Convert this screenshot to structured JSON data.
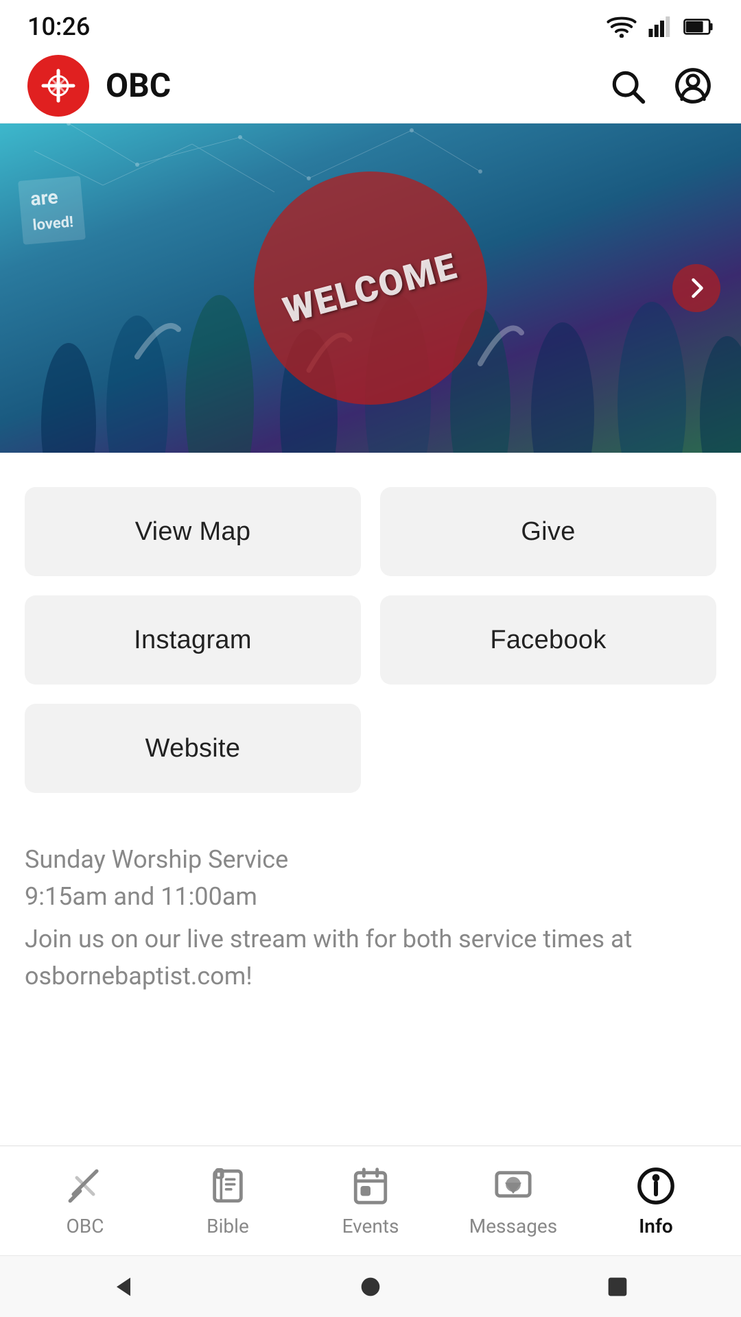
{
  "statusBar": {
    "time": "10:26"
  },
  "header": {
    "appTitle": "OBC",
    "logoAlt": "OBC logo"
  },
  "hero": {
    "welcomeText": "WELCOME"
  },
  "buttons": {
    "viewMap": "View Map",
    "give": "Give",
    "instagram": "Instagram",
    "facebook": "Facebook",
    "website": "Website"
  },
  "infoText": {
    "line1": "Sunday Worship Service",
    "line2": "9:15am and 11:00am",
    "line3": "Join us on our live stream with for both service times at osbornebaptist.com!"
  },
  "bottomNav": {
    "items": [
      {
        "id": "obc",
        "label": "OBC",
        "active": false
      },
      {
        "id": "bible",
        "label": "Bible",
        "active": false
      },
      {
        "id": "events",
        "label": "Events",
        "active": false
      },
      {
        "id": "messages",
        "label": "Messages",
        "active": false
      },
      {
        "id": "info",
        "label": "Info",
        "active": true
      }
    ]
  },
  "androidNav": {
    "back": "◀",
    "home": "●",
    "recents": "■"
  }
}
